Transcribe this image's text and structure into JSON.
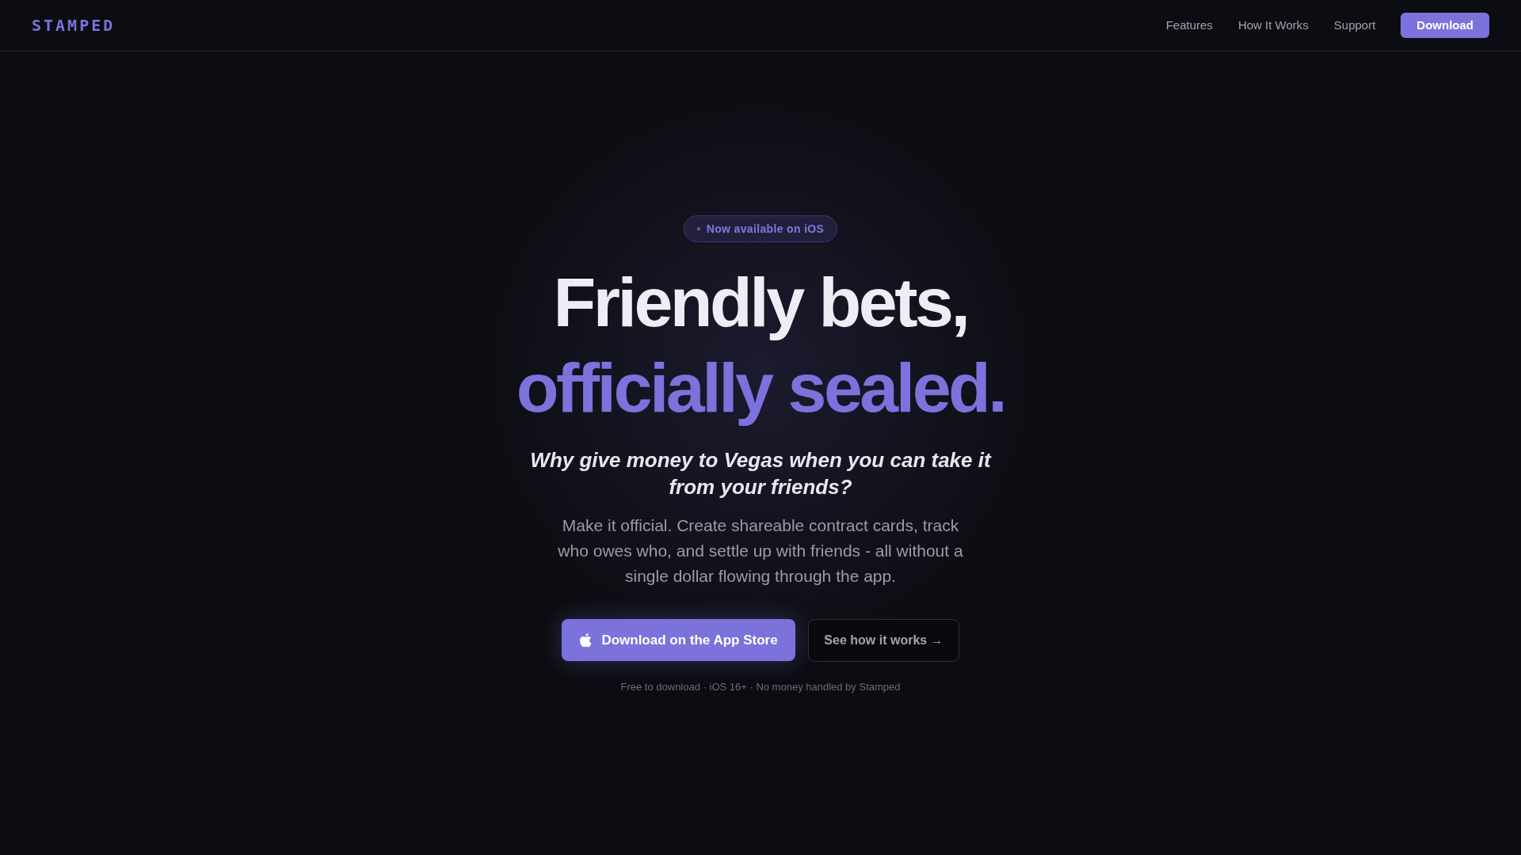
{
  "nav": {
    "logo": "STAMPED",
    "links": [
      "Features",
      "How It Works",
      "Support"
    ],
    "cta": "Download"
  },
  "hero": {
    "badge": "Now available on iOS",
    "title_line_1": "Friendly bets,",
    "title_line_2": "officially sealed.",
    "tagline": "Why give money to Vegas when you can take it from your friends?",
    "description": "Make it official. Create shareable contract cards, track who owes who, and settle up with friends - all without a single dollar flowing through the app.",
    "primary_button": "Download on the App Store",
    "secondary_button": "See how it works →",
    "footnote": "Free to download · iOS 16+ · No money handled by Stamped"
  }
}
